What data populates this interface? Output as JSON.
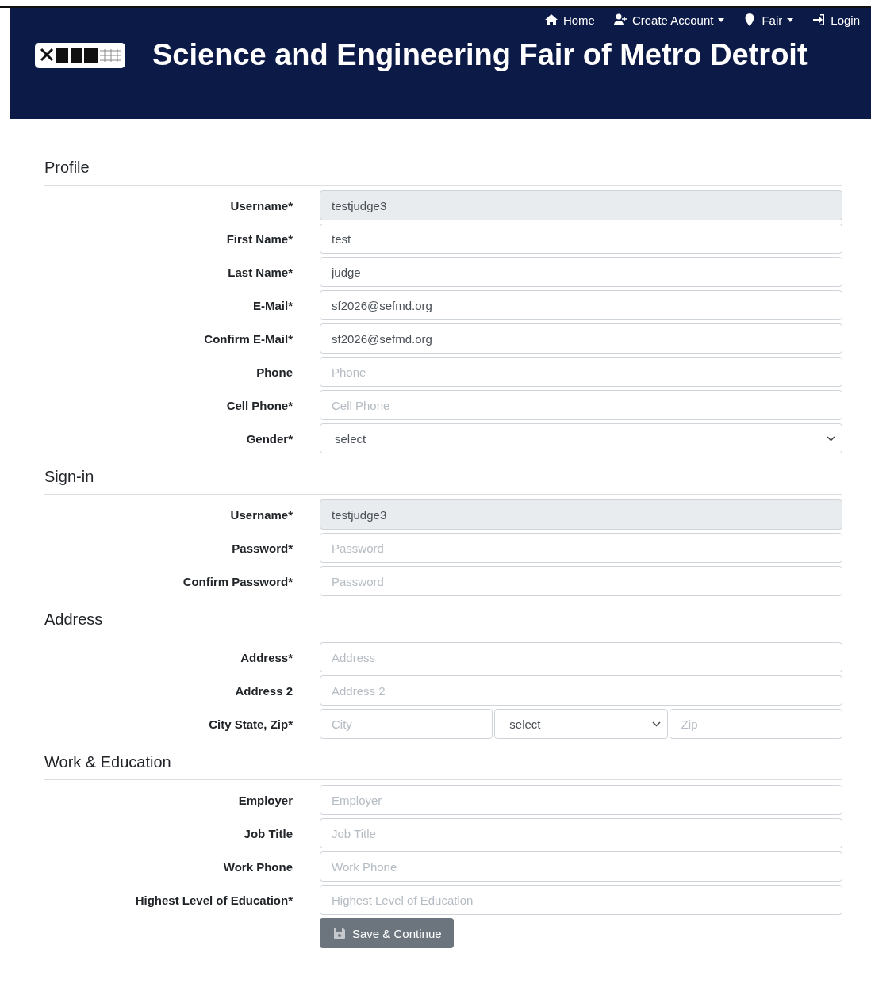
{
  "nav": [
    {
      "kind": "home",
      "label": "Home",
      "menu": false
    },
    {
      "kind": "account",
      "label": "Create Account",
      "menu": true
    },
    {
      "kind": "fair",
      "label": "Fair",
      "menu": true
    },
    {
      "kind": "login",
      "label": "Login",
      "menu": false
    }
  ],
  "site_title": "Science and Engineering Fair of Metro Detroit",
  "sections": [
    {
      "title": "Profile",
      "fields": [
        {
          "label": "Username*",
          "kind": "text",
          "value": "testjudge3",
          "disabled": true
        },
        {
          "label": "First Name*",
          "kind": "text",
          "value": "test",
          "disabled": false
        },
        {
          "label": "Last Name*",
          "kind": "text",
          "value": "judge",
          "disabled": false
        },
        {
          "label": "E-Mail*",
          "kind": "text",
          "value": "sf2026@sefmd.org",
          "disabled": false
        },
        {
          "label": "Confirm E-Mail*",
          "kind": "text",
          "value": "sf2026@sefmd.org",
          "disabled": false
        },
        {
          "label": "Phone",
          "kind": "text",
          "placeholder": "Phone",
          "disabled": false
        },
        {
          "label": "Cell Phone*",
          "kind": "text",
          "placeholder": "Cell Phone",
          "disabled": false
        },
        {
          "label": "Gender*",
          "kind": "select",
          "value": "select",
          "disabled": false
        }
      ]
    },
    {
      "title": "Sign-in",
      "fields": [
        {
          "label": "Username*",
          "kind": "text",
          "value": "testjudge3",
          "disabled": true
        },
        {
          "label": "Password*",
          "kind": "text",
          "placeholder": "Password",
          "disabled": false
        },
        {
          "label": "Confirm Password*",
          "kind": "text",
          "placeholder": "Password",
          "disabled": false
        }
      ]
    },
    {
      "title": "Address",
      "fields": [
        {
          "label": "Address*",
          "kind": "text",
          "placeholder": "Address",
          "disabled": false
        },
        {
          "label": "Address 2",
          "kind": "text",
          "placeholder": "Address 2",
          "disabled": false
        },
        {
          "label": "City State, Zip*",
          "kind": "group",
          "parts": [
            {
              "kind": "text",
              "placeholder": "City",
              "disabled": false
            },
            {
              "kind": "select",
              "value": "select",
              "disabled": false
            },
            {
              "kind": "text",
              "placeholder": "Zip",
              "disabled": false
            }
          ]
        }
      ]
    },
    {
      "title": "Work & Education",
      "fields": [
        {
          "label": "Employer",
          "kind": "text",
          "placeholder": "Employer",
          "disabled": false
        },
        {
          "label": "Job Title",
          "kind": "text",
          "placeholder": "Job Title",
          "disabled": false
        },
        {
          "label": "Work Phone",
          "kind": "text",
          "placeholder": "Work Phone",
          "disabled": false
        },
        {
          "label": "Highest Level of Education*",
          "kind": "text",
          "placeholder": "Highest Level of Education",
          "disabled": false
        }
      ]
    }
  ],
  "submit": {
    "label": "Save & Continue"
  }
}
